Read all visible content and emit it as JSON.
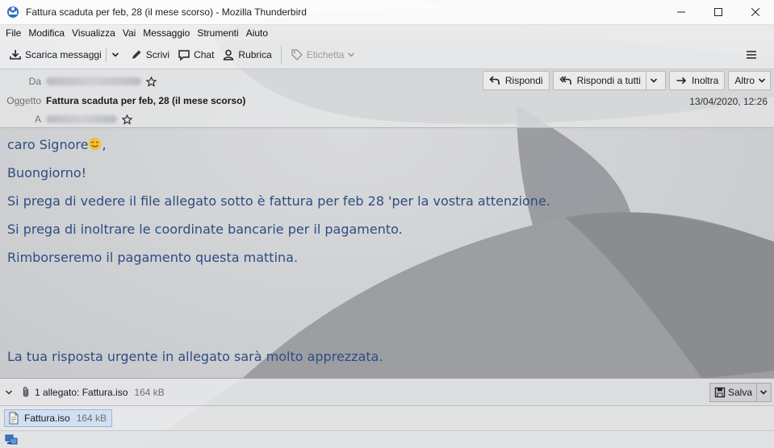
{
  "window": {
    "title": "Fattura scaduta per feb, 28 (il mese scorso) - Mozilla Thunderbird",
    "app_icon": "thunderbird-icon"
  },
  "menu": [
    "File",
    "Modifica",
    "Visualizza",
    "Vai",
    "Messaggio",
    "Strumenti",
    "Aiuto"
  ],
  "toolbar": {
    "get_messages": "Scarica messaggi",
    "write": "Scrivi",
    "chat": "Chat",
    "address_book": "Rubrica",
    "tag": "Etichetta"
  },
  "header": {
    "from_label": "Da",
    "subject_label": "Oggetto",
    "subject": "Fattura scaduta per feb, 28 (il mese scorso)",
    "to_label": "A",
    "date": "13/04/2020, 12:26",
    "reply": "Rispondi",
    "reply_all": "Rispondi a tutti",
    "forward": "Inoltra",
    "more": "Altro"
  },
  "body": {
    "greeting": "caro Signore",
    "greeting_suffix": ",",
    "line1": "Buongiorno!",
    "line2": "Si prega di vedere il file allegato sotto è fattura per feb 28 'per la vostra attenzione.",
    "line3": "Si prega di inoltrare le coordinate bancarie per il pagamento.",
    "line4": "Rimborseremo il pagamento questa mattina.",
    "line5": "La tua risposta urgente in allegato sarà molto apprezzata."
  },
  "attachments": {
    "summary": "1 allegato: Fattura.iso",
    "summary_size": "164 kB",
    "save": "Salva",
    "items": [
      {
        "name": "Fattura.iso",
        "size": "164 kB"
      }
    ]
  },
  "colors": {
    "body_text": "#2e4d82",
    "chip_bg": "#cfe0f5"
  }
}
